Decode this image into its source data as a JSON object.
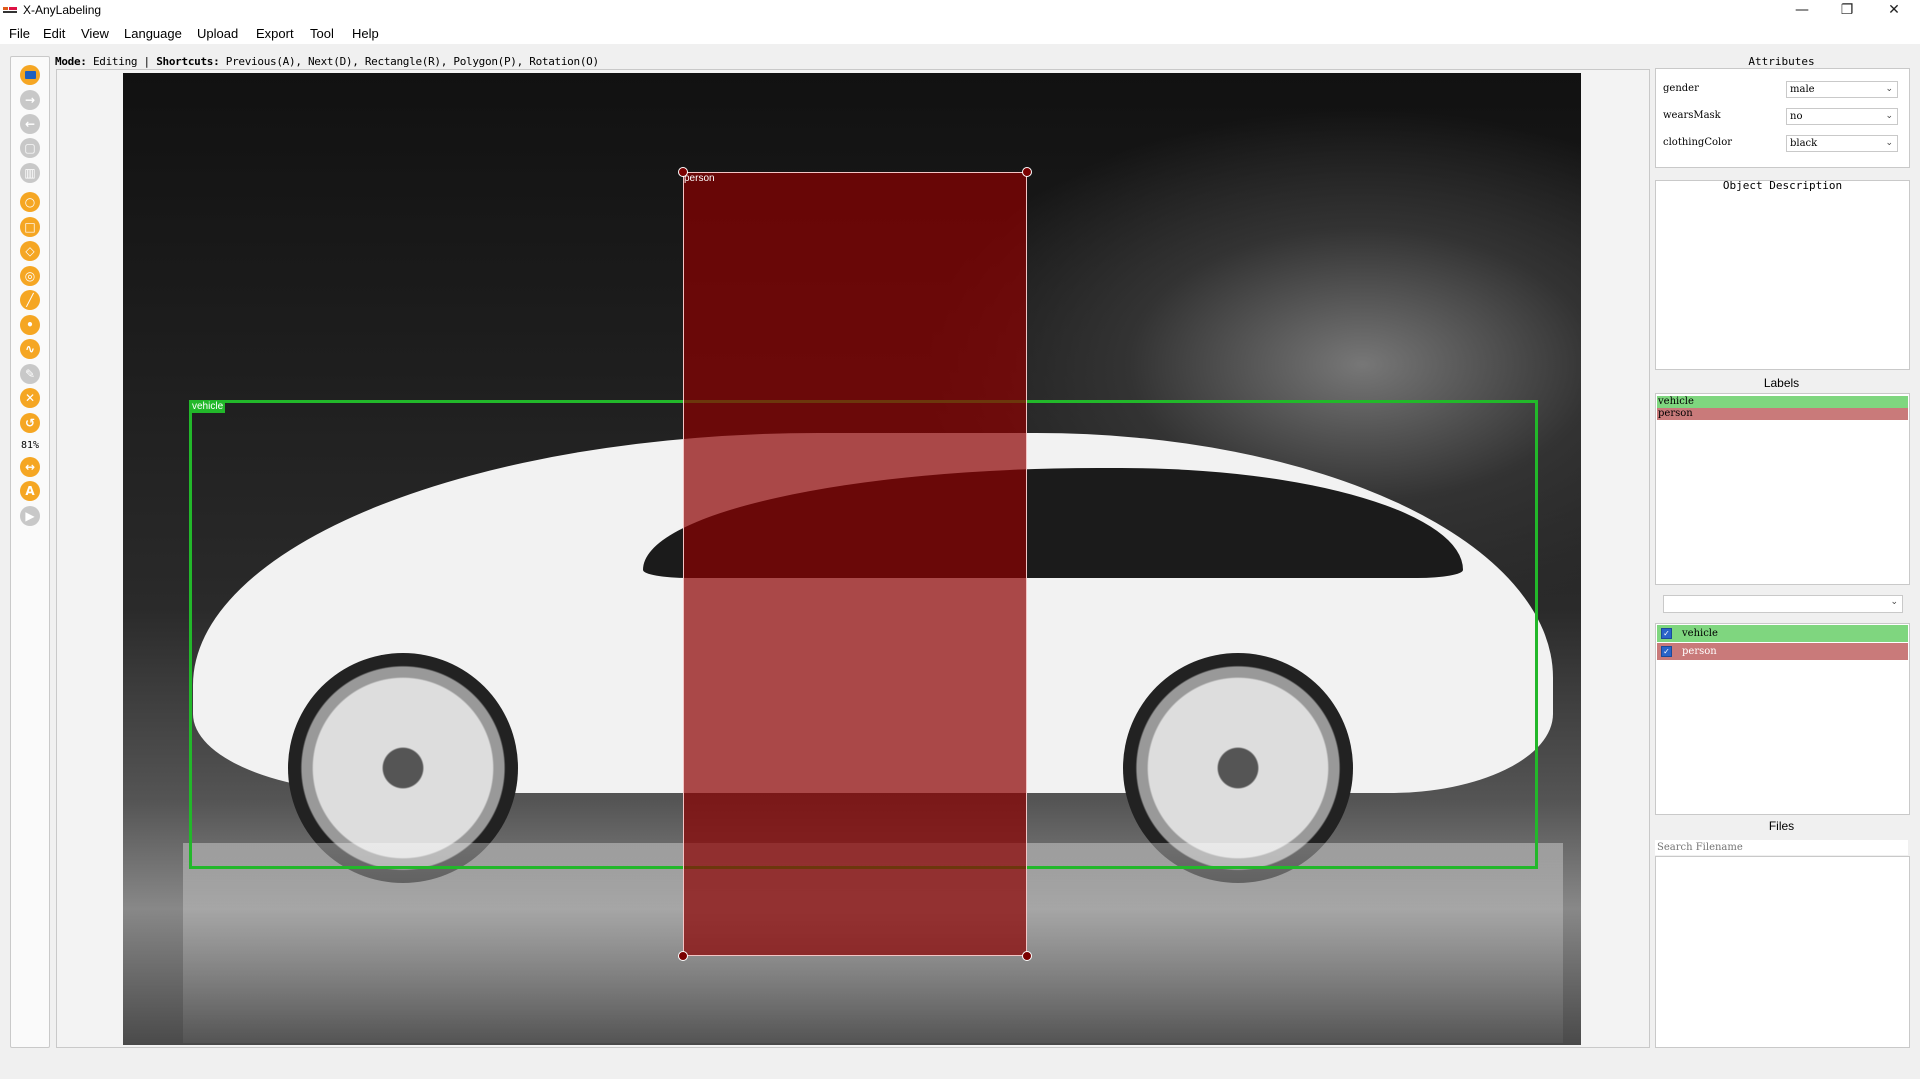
{
  "window": {
    "title": "X-AnyLabeling",
    "controls": [
      "—",
      "❐",
      "✕"
    ]
  },
  "menu": [
    "File",
    "Edit",
    "View",
    "Language",
    "Upload",
    "Export",
    "Tool",
    "Help"
  ],
  "toolbar": {
    "zoom": "81%",
    "tools": [
      "open-folder-icon",
      "next-icon",
      "prev-icon",
      "save-icon",
      "delete-icon",
      "circle-icon",
      "rectangle-icon",
      "polygon-icon",
      "rotation-icon",
      "line-icon",
      "point-icon",
      "linestrip-icon",
      "edit-icon",
      "close-icon",
      "undo-icon",
      "fit-width-icon",
      "auto-label-icon",
      "run-icon"
    ]
  },
  "modeline": {
    "mode_key": "Mode:",
    "mode_value": "Editing",
    "shortcuts_key": "Shortcuts:",
    "shortcuts_value": "Previous(A), Next(D), Rectangle(R), Polygon(P), Rotation(O)"
  },
  "canvas": {
    "annotations": [
      {
        "label": "vehicle",
        "color": "#22b82a"
      },
      {
        "label": "person",
        "color": "#8c0000"
      }
    ]
  },
  "attributes": {
    "title": "Attributes",
    "fields": [
      {
        "name": "gender",
        "value": "male"
      },
      {
        "name": "wearsMask",
        "value": "no"
      },
      {
        "name": "clothingColor",
        "value": "black"
      }
    ],
    "description_title": "Object Description"
  },
  "labels_panel": {
    "title": "Labels",
    "items": [
      {
        "label": "vehicle",
        "color": "#7fd67f"
      },
      {
        "label": "person",
        "color": "#c97a7a"
      }
    ]
  },
  "shapes_panel": {
    "items": [
      {
        "label": "vehicle",
        "color": "#7fd67f",
        "checked": true
      },
      {
        "label": "person",
        "color": "#c97a7a",
        "checked": true
      }
    ]
  },
  "files_panel": {
    "title": "Files",
    "search_placeholder": "Search Filename"
  }
}
